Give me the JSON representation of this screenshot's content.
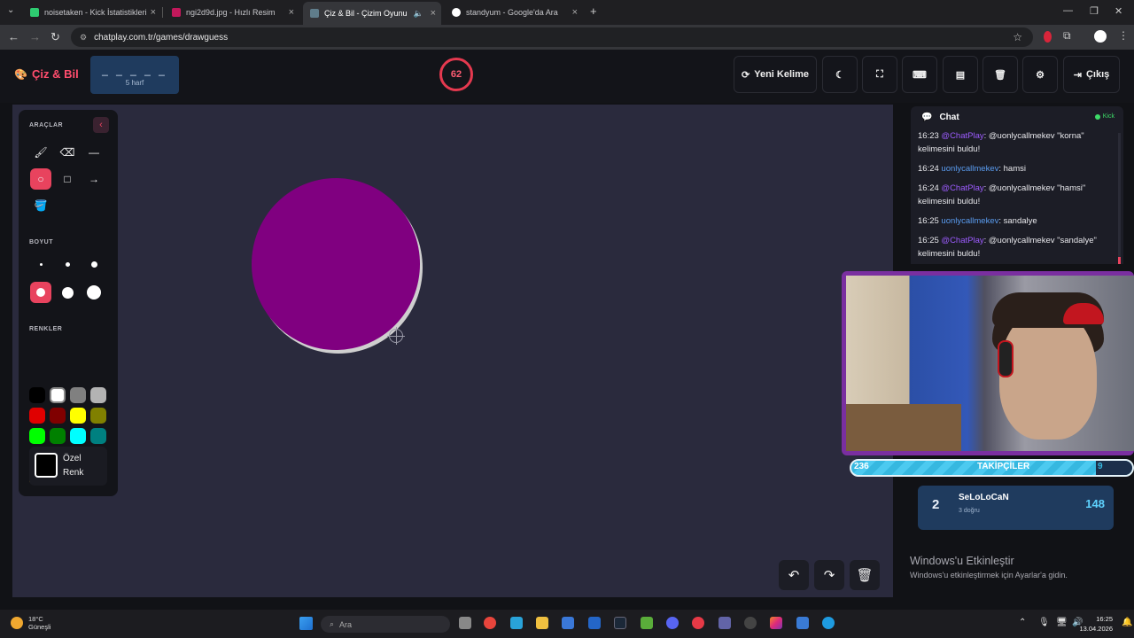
{
  "browser": {
    "tabs": [
      {
        "title": "noisetaken - Kick İstatistikleri",
        "favicon_color": "#2ecc71"
      },
      {
        "title": "ngi2d9d.jpg - Hızlı Resim",
        "favicon_color": "#c2185b"
      },
      {
        "title": "Çiz & Bil - Çizim Oyunu",
        "favicon_color": "#607d8b"
      },
      {
        "title": "standyum - Google'da Ara",
        "favicon_color": "#ffffff"
      }
    ],
    "url": "chatplay.com.tr/games/drawguess"
  },
  "app": {
    "logo": "Çiz & Bil",
    "word_blanks": "_ _ _ _ _",
    "word_hint": "5 harf",
    "timer": "62",
    "buttons": {
      "new_word": "Yeni Kelime",
      "exit": "Çıkış"
    }
  },
  "tools": {
    "section_tools": "ARAÇLAR",
    "section_size": "BOYUT",
    "section_colors": "RENKLER",
    "custom_color_line1": "Özel",
    "custom_color_line2": "Renk",
    "swatches": [
      "#000000",
      "#ffffff",
      "#808080",
      "#b3b3b3",
      "#e00000",
      "#800000",
      "#ffff00",
      "#808000",
      "#00ff00",
      "#008000",
      "#00ffff",
      "#008080",
      "#0000ff",
      "#000080",
      "#ff00ff",
      "#800080",
      "#f0a000",
      "#a52a2a",
      "#f4b6c2",
      "#ffd700"
    ],
    "selected_color": "#800080"
  },
  "chat": {
    "title": "Chat",
    "platform": "Kick",
    "messages": [
      {
        "time": "16:23",
        "user": "@ChatPlay",
        "text": ": @uonlycallmekev \"korna\" kelimesini buldu!"
      },
      {
        "time": "16:24",
        "user": "uonlycallmekev",
        "text": ": hamsi"
      },
      {
        "time": "16:24",
        "user": "@ChatPlay",
        "text": ": @uonlycallmekev \"hamsi\" kelimesini buldu!"
      },
      {
        "time": "16:25",
        "user": "uonlycallmekev",
        "text": ": sandalye"
      },
      {
        "time": "16:25",
        "user": "@ChatPlay",
        "text": ": @uonlycallmekev \"sandalye\" kelimesini buldu!"
      }
    ]
  },
  "followers": {
    "count": "236",
    "label": "TAKİPÇİLER",
    "goal_partial": "9"
  },
  "leaderboard": {
    "rank": "2",
    "name": "SeLoLoCaN",
    "sub": "3 doğru",
    "score": "148"
  },
  "watermark": {
    "line1": "Windows'u Etkinleştir",
    "line2": "Windows'u etkinleştirmek için Ayarlar'a gidin."
  },
  "taskbar": {
    "temp": "18°C",
    "weather": "Güneşli",
    "search": "Ara",
    "time": "16:25",
    "date": "13.04.2026"
  }
}
